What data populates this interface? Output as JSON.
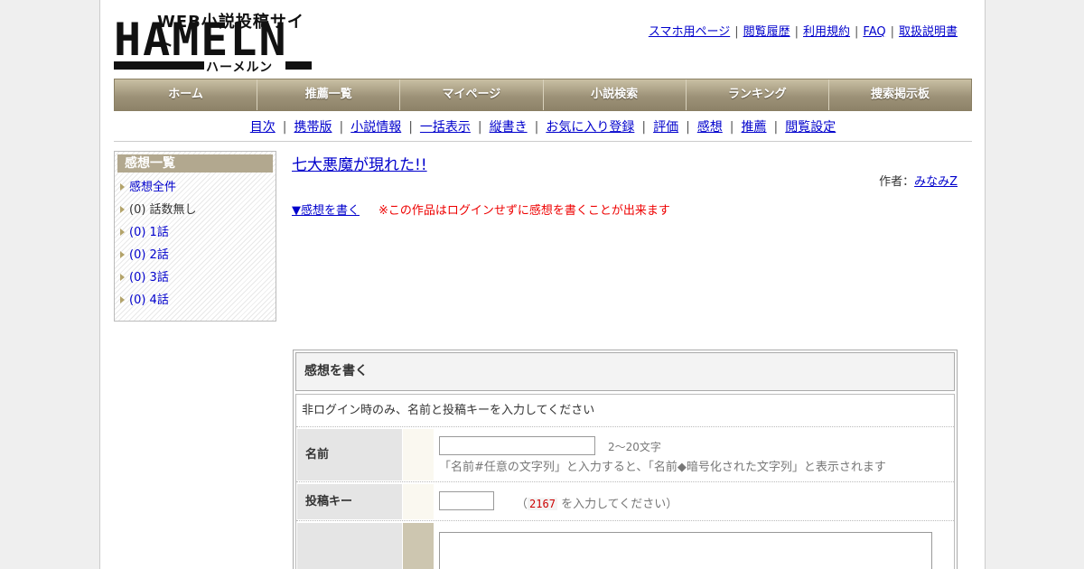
{
  "logo": {
    "tagline": "WEB小説投稿サイト",
    "name": "HAMELN",
    "kana": "ハーメルン"
  },
  "top_links": [
    "スマホ用ページ",
    "閲覧履歴",
    "利用規約",
    "FAQ",
    "取扱説明書"
  ],
  "global_nav": [
    "ホーム",
    "推薦一覧",
    "マイページ",
    "小説検索",
    "ランキング",
    "捜索掲示板"
  ],
  "sub_nav": [
    "目次",
    "携帯版",
    "小説情報",
    "一括表示",
    "縦書き",
    "お気に入り登録",
    "評価",
    "感想",
    "推薦",
    "閲覧設定"
  ],
  "sidebar": {
    "title": "感想一覧",
    "items": [
      {
        "label": "感想全件",
        "link": true
      },
      {
        "label": "(0) 話数無し",
        "link": false
      },
      {
        "label": "(0) 1話",
        "link": true
      },
      {
        "label": "(0) 2話",
        "link": true
      },
      {
        "label": "(0) 3話",
        "link": true
      },
      {
        "label": "(0) 4話",
        "link": true
      }
    ]
  },
  "main": {
    "title": "七大悪魔が現れた!!",
    "author_label": "作者：",
    "author": "みなみZ",
    "write_link": "▼感想を書く",
    "notice": "※この作品はログインせずに感想を書くことが出来ます"
  },
  "form": {
    "title": "感想を書く",
    "note": "非ログイン時のみ、名前と投稿キーを入力してください",
    "name_label": "名前",
    "name_hint": "2～20文字",
    "name_hint2": "「名前#任意の文字列」と入力すると、「名前◆暗号化された文字列」と表示されます",
    "key_label": "投稿キー",
    "key_hint_prefix": "（",
    "key_code": "2167",
    "key_hint_suffix": "を入力してください）"
  }
}
